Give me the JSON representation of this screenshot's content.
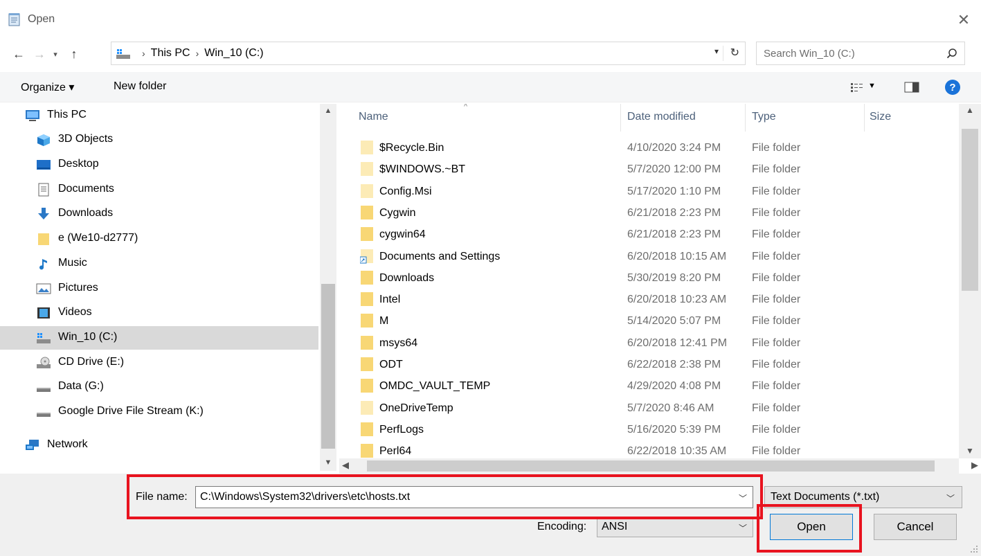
{
  "window": {
    "title": "Open"
  },
  "address": {
    "crumbs": [
      "This PC",
      "Win_10 (C:)"
    ],
    "search_placeholder": "Search Win_10 (C:)"
  },
  "toolbar": {
    "organize": "Organize ▾",
    "new_folder": "New folder"
  },
  "nav": {
    "items": [
      {
        "label": "This PC",
        "icon": "computer-icon"
      },
      {
        "label": "3D Objects",
        "icon": "3d-objects-icon"
      },
      {
        "label": "Desktop",
        "icon": "desktop-icon"
      },
      {
        "label": "Documents",
        "icon": "documents-icon"
      },
      {
        "label": "Downloads",
        "icon": "downloads-icon"
      },
      {
        "label": "e (We10-d2777)",
        "icon": "folder-icon"
      },
      {
        "label": "Music",
        "icon": "music-icon"
      },
      {
        "label": "Pictures",
        "icon": "pictures-icon"
      },
      {
        "label": "Videos",
        "icon": "videos-icon"
      },
      {
        "label": "Win_10 (C:)",
        "icon": "windows-drive-icon",
        "selected": true
      },
      {
        "label": "CD Drive (E:)",
        "icon": "cd-drive-icon"
      },
      {
        "label": "Data (G:)",
        "icon": "drive-icon"
      },
      {
        "label": "Google Drive File Stream (K:)",
        "icon": "drive-icon"
      },
      {
        "label": "Network",
        "icon": "network-icon"
      }
    ]
  },
  "columns": {
    "name": "Name",
    "date": "Date modified",
    "type": "Type",
    "size": "Size"
  },
  "files": [
    {
      "name": "$Recycle.Bin",
      "date": "4/10/2020 3:24 PM",
      "type": "File folder",
      "pale": true
    },
    {
      "name": "$WINDOWS.~BT",
      "date": "5/7/2020 12:00 PM",
      "type": "File folder",
      "pale": true
    },
    {
      "name": "Config.Msi",
      "date": "5/17/2020 1:10 PM",
      "type": "File folder",
      "pale": true
    },
    {
      "name": "Cygwin",
      "date": "6/21/2018 2:23 PM",
      "type": "File folder"
    },
    {
      "name": "cygwin64",
      "date": "6/21/2018 2:23 PM",
      "type": "File folder"
    },
    {
      "name": "Documents and Settings",
      "date": "6/20/2018 10:15 AM",
      "type": "File folder",
      "pale": true,
      "shortcut": true
    },
    {
      "name": "Downloads",
      "date": "5/30/2019 8:20 PM",
      "type": "File folder"
    },
    {
      "name": "Intel",
      "date": "6/20/2018 10:23 AM",
      "type": "File folder"
    },
    {
      "name": "M",
      "date": "5/14/2020 5:07 PM",
      "type": "File folder"
    },
    {
      "name": "msys64",
      "date": "6/20/2018 12:41 PM",
      "type": "File folder"
    },
    {
      "name": "ODT",
      "date": "6/22/2018 2:38 PM",
      "type": "File folder"
    },
    {
      "name": "OMDC_VAULT_TEMP",
      "date": "4/29/2020 4:08 PM",
      "type": "File folder"
    },
    {
      "name": "OneDriveTemp",
      "date": "5/7/2020 8:46 AM",
      "type": "File folder",
      "pale": true
    },
    {
      "name": "PerfLogs",
      "date": "5/16/2020 5:39 PM",
      "type": "File folder"
    },
    {
      "name": "Perl64",
      "date": "6/22/2018 10:35 AM",
      "type": "File folder"
    }
  ],
  "bottom": {
    "file_name_label": "File name:",
    "file_name_value": "C:\\Windows\\System32\\drivers\\etc\\hosts.txt",
    "filter_value": "Text Documents (*.txt)",
    "encoding_label": "Encoding:",
    "encoding_value": "ANSI",
    "open_label": "Open",
    "cancel_label": "Cancel"
  },
  "colors": {
    "highlight": "#e8131f",
    "folder": "#f8d775",
    "folder_pale": "#fcebb6",
    "accent": "#0078d7"
  }
}
